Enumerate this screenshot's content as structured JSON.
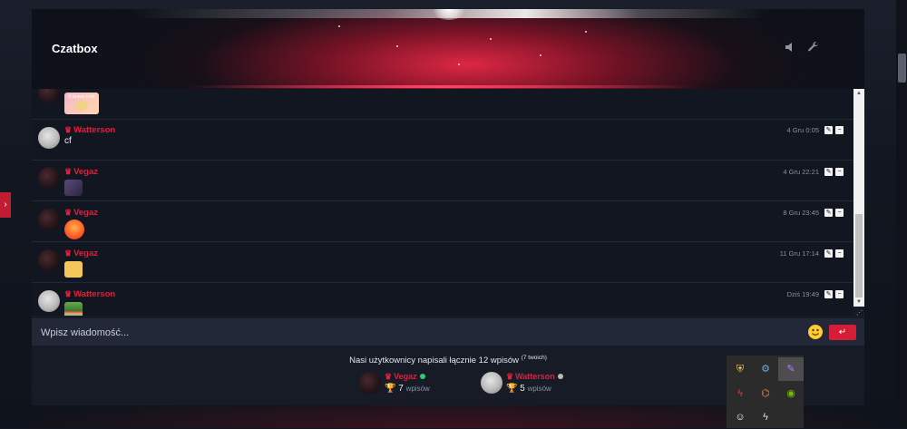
{
  "chatbox": {
    "title": "Czatbox",
    "sound_icon": "speaker-icon",
    "settings_icon": "wrench-icon"
  },
  "messages": [
    {
      "author": "",
      "time": "",
      "content": "",
      "image_caption": "® brown lmbt",
      "avatar": "dark",
      "image": "sticker-image"
    },
    {
      "author": "Watterson",
      "time": "4 Gru 0:05",
      "content": "cf",
      "avatar": "light"
    },
    {
      "author": "Vegaz",
      "time": "4 Gru 22:21",
      "content": "",
      "avatar": "dark",
      "image": "emoji-image"
    },
    {
      "author": "Vegaz",
      "time": "8 Gru 23:45",
      "content": "",
      "avatar": "dark",
      "image": "angry-emoji-image"
    },
    {
      "author": "Vegaz",
      "time": "11 Gru 17:14",
      "content": "",
      "avatar": "dark",
      "image": "thumbs-emoji-image"
    },
    {
      "author": "Watterson",
      "time": "Dziś 19:49",
      "content": "",
      "avatar": "light",
      "image": "pepe-emoji-image"
    }
  ],
  "input": {
    "placeholder": "Wpisz wiadomość...",
    "send_label": "↵"
  },
  "stats": {
    "text": "Nasi użytkownicy napisali łącznie 12 wpisów",
    "sup": "(7 twoich)"
  },
  "top_users": [
    {
      "name": "Vegaz",
      "count": "7",
      "unit": "wpisów",
      "status_color": "#2ecc71"
    },
    {
      "name": "Watterson",
      "count": "5",
      "unit": "wpisów",
      "status_color": "#bbbbbb"
    }
  ],
  "colors": {
    "accent": "#e01f3d",
    "background": "#171b26"
  },
  "tray_icons": [
    "shield-icon",
    "steam-icon",
    "feather-icon",
    "lightning-icon",
    "network-icon",
    "nvidia-icon",
    "discord-icon",
    "fan-icon"
  ]
}
